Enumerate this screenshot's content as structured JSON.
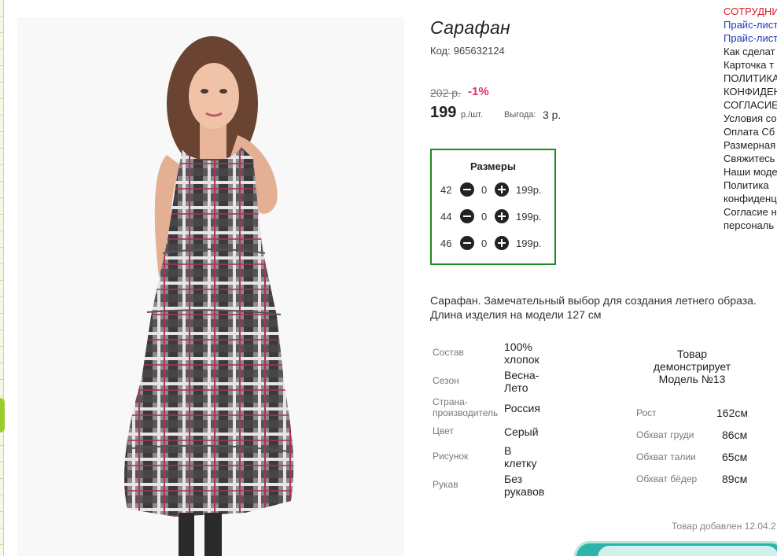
{
  "product": {
    "title": "Сарафан",
    "code_label": "Код:",
    "code": "965632124",
    "old_price": "202 р.",
    "discount": "-1%",
    "price": "199",
    "price_unit": "р./шт.",
    "saving_label": "Выгода:",
    "saving_value": "3 р."
  },
  "sizes": {
    "title": "Размеры",
    "rows": [
      {
        "size": "42",
        "qty": "0",
        "price": "199р."
      },
      {
        "size": "44",
        "qty": "0",
        "price": "199р."
      },
      {
        "size": "46",
        "qty": "0",
        "price": "199р."
      }
    ]
  },
  "description": {
    "line1": "Сарафан. Замечательный выбор для создания летнего образа.",
    "line2": "Длина изделия на модели 127 см"
  },
  "specs": [
    {
      "label": "Состав",
      "value_line1": "100%",
      "value_line2": "хлопок"
    },
    {
      "label": "Сезон",
      "value_line1": "Весна-",
      "value_line2": "Лето"
    },
    {
      "label_line1": "Страна-",
      "label_line2": "производитель",
      "value_line1": "Россия"
    },
    {
      "label": "Цвет",
      "value_line1": "Серый"
    },
    {
      "label": "Рисунок",
      "value_line1": "В",
      "value_line2": "клетку"
    },
    {
      "label": "Рукав",
      "value_line1": "Без",
      "value_line2": "рукавов"
    }
  ],
  "model": {
    "head_line1": "Товар",
    "head_line2": "демонстрирует",
    "head_line3": "Модель №13",
    "rows": [
      {
        "label": "Рост",
        "value": "162см"
      },
      {
        "label": "Обхват груди",
        "value": "86см"
      },
      {
        "label": "Обхват талии",
        "value": "65см"
      },
      {
        "label": "Обхват бёдер",
        "value": "89см"
      }
    ]
  },
  "added_text": "Товар добавлен 12.04.2",
  "right_links": [
    {
      "text": "СОТРУДНИ",
      "style": "red"
    },
    {
      "text": "Прайс-лист",
      "style": "blue"
    },
    {
      "text": "Прайс-лист",
      "style": "blue"
    },
    {
      "text": "Как сделат",
      "style": "plain"
    },
    {
      "text": "Карточка т",
      "style": "plain"
    },
    {
      "text": "ПОЛИТИКА",
      "style": "plain"
    },
    {
      "text": "КОНФИДЕН",
      "style": "plain"
    },
    {
      "text": "СОГЛАСИЕ",
      "style": "plain"
    },
    {
      "text": "Условия со",
      "style": "plain"
    },
    {
      "text": "Оплата Сб",
      "style": "plain"
    },
    {
      "text": "Размерная",
      "style": "plain"
    },
    {
      "text": "Свяжитесь",
      "style": "plain"
    },
    {
      "text": "Наши моде",
      "style": "plain"
    },
    {
      "text": "Политика",
      "style": "plain"
    },
    {
      "text": "конфиденц",
      "style": "plain"
    },
    {
      "text": "Согласие н",
      "style": "plain"
    },
    {
      "text": "персональ",
      "style": "plain"
    }
  ],
  "colors": {
    "discount": "#e0306a",
    "sizes_border": "#1f8a1f",
    "cart_button": "#2cb5a8",
    "link_red": "#d81f26",
    "link_blue": "#1c3bb8"
  }
}
